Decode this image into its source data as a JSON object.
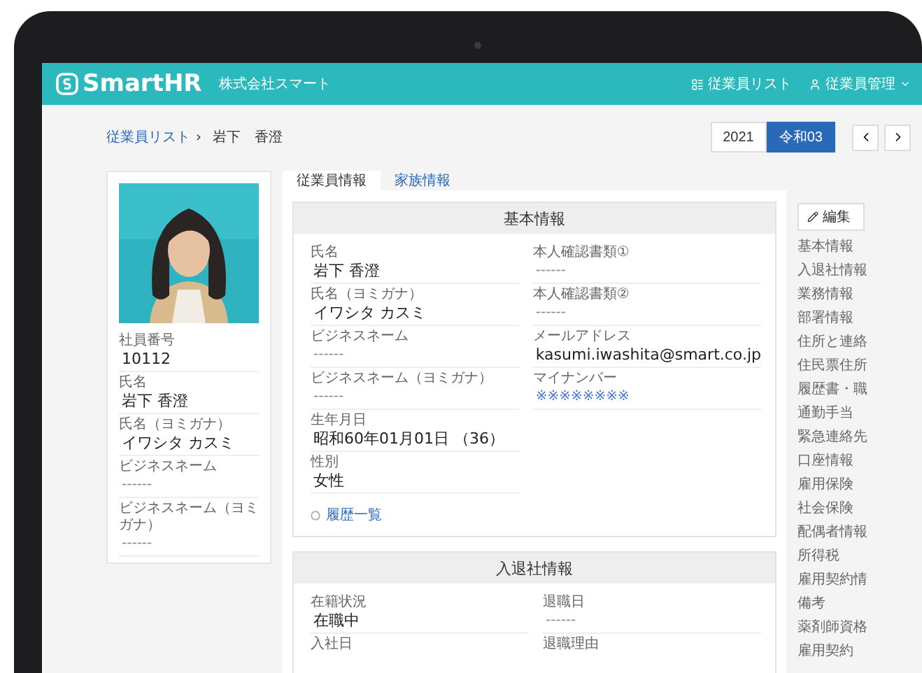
{
  "header": {
    "logo": "SmartHR",
    "company": "株式会社スマート",
    "nav": [
      {
        "kind": "list",
        "label": "従業員リスト"
      },
      {
        "kind": "user-menu",
        "label": "従業員管理"
      }
    ]
  },
  "breadcrumb": {
    "separator": "›",
    "items": [
      {
        "kind": "link",
        "label": "従業員リスト"
      },
      {
        "kind": "current",
        "label": "岩下　香澄"
      }
    ]
  },
  "year_switch": [
    {
      "label": "2021",
      "selected": false
    },
    {
      "label": "令和03",
      "selected": true
    }
  ],
  "profile": {
    "fields": [
      {
        "label": "社員番号",
        "value": "10112",
        "kind": "text"
      },
      {
        "label": "氏名",
        "value": "岩下 香澄",
        "kind": "text"
      },
      {
        "label": "氏名（ヨミガナ）",
        "value": "イワシタ カスミ",
        "kind": "text"
      },
      {
        "label": "ビジネスネーム",
        "value": "------",
        "kind": "empty"
      },
      {
        "label": "ビジネスネーム（ヨミガナ）",
        "value": "------",
        "kind": "empty"
      }
    ]
  },
  "tabs": [
    {
      "label": "従業員情報",
      "selected": true
    },
    {
      "label": "家族情報",
      "selected": false
    }
  ],
  "sections": [
    {
      "title": "基本情報",
      "columns": [
        [
          {
            "label": "氏名",
            "value": "岩下 香澄",
            "kind": "text"
          },
          {
            "label": "氏名（ヨミガナ）",
            "value": "イワシタ カスミ",
            "kind": "text"
          },
          {
            "label": "ビジネスネーム",
            "value": "------",
            "kind": "empty"
          },
          {
            "label": "ビジネスネーム（ヨミガナ）",
            "value": "------",
            "kind": "empty"
          },
          {
            "label": "生年月日",
            "value": "昭和60年01月01日 （36）",
            "kind": "text"
          },
          {
            "label": "性別",
            "value": "女性",
            "kind": "text"
          }
        ],
        [
          {
            "label": "本人確認書類①",
            "value": "------",
            "kind": "empty"
          },
          {
            "label": "本人確認書類②",
            "value": "------",
            "kind": "empty"
          },
          {
            "label": "メールアドレス",
            "value": "kasumi.iwashita@smart.co.jp",
            "kind": "text"
          },
          {
            "label": "マイナンバー",
            "value": "※※※※※※※※",
            "kind": "masked"
          }
        ]
      ],
      "link": "履歴一覧"
    },
    {
      "title": "入退社情報",
      "columns": [
        [
          {
            "label": "在籍状況",
            "value": "在職中",
            "kind": "text"
          },
          {
            "label": "入社日"
          }
        ],
        [
          {
            "label": "退職日",
            "value": "------",
            "kind": "empty"
          },
          {
            "label": "退職理由"
          }
        ]
      ]
    }
  ],
  "side_nav": {
    "edit_button": "編集",
    "items": [
      "基本情報",
      "入退社情報",
      "業務情報",
      "部署情報",
      "住所と連絡",
      "住民票住所",
      "履歴書・職",
      "通勤手当",
      "緊急連絡先",
      "口座情報",
      "雇用保険",
      "社会保険",
      "配偶者情報",
      "所得税",
      "雇用契約情",
      "備考",
      "薬剤師資格",
      "雇用契約"
    ]
  }
}
